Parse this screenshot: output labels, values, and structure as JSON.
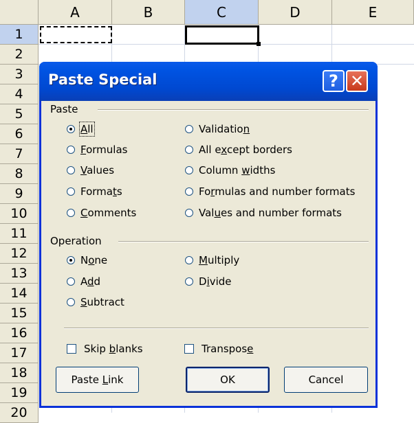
{
  "sheet": {
    "columns": [
      "A",
      "B",
      "C",
      "D",
      "E"
    ],
    "rows": [
      "1",
      "2",
      "3",
      "4",
      "5",
      "6",
      "7",
      "8",
      "9",
      "10",
      "11",
      "12",
      "13",
      "14",
      "15",
      "16",
      "17",
      "18",
      "19",
      "20"
    ]
  },
  "dialog": {
    "title": "Paste Special",
    "help_label": "?",
    "close_label": "✕",
    "paste_group": "Paste",
    "paste_options": [
      {
        "pre": "",
        "key": "A",
        "post": "ll",
        "checked": true
      },
      {
        "pre": "",
        "key": "F",
        "post": "ormulas",
        "checked": false
      },
      {
        "pre": "",
        "key": "V",
        "post": "alues",
        "checked": false
      },
      {
        "pre": "Forma",
        "key": "t",
        "post": "s",
        "checked": false
      },
      {
        "pre": "",
        "key": "C",
        "post": "omments",
        "checked": false
      },
      {
        "pre": "Validatio",
        "key": "n",
        "post": "",
        "checked": false
      },
      {
        "pre": "All e",
        "key": "x",
        "post": "cept borders",
        "checked": false
      },
      {
        "pre": "Column ",
        "key": "w",
        "post": "idths",
        "checked": false
      },
      {
        "pre": "Fo",
        "key": "r",
        "post": "mulas and number formats",
        "checked": false
      },
      {
        "pre": "Val",
        "key": "u",
        "post": "es and number formats",
        "checked": false
      }
    ],
    "operation_group": "Operation",
    "operation_options": [
      {
        "pre": "N",
        "key": "o",
        "post": "ne",
        "checked": true
      },
      {
        "pre": "A",
        "key": "d",
        "post": "d",
        "checked": false
      },
      {
        "pre": "",
        "key": "S",
        "post": "ubtract",
        "checked": false
      },
      {
        "pre": "",
        "key": "M",
        "post": "ultiply",
        "checked": false
      },
      {
        "pre": "D",
        "key": "i",
        "post": "vide",
        "checked": false
      }
    ],
    "skip_blanks": {
      "pre": "Skip ",
      "key": "b",
      "post": "lanks",
      "checked": false
    },
    "transpose": {
      "pre": "Transpos",
      "key": "e",
      "post": "",
      "checked": false
    },
    "paste_link": {
      "pre": "Paste ",
      "key": "L",
      "post": "ink"
    },
    "ok_label": "OK",
    "cancel_label": "Cancel"
  }
}
